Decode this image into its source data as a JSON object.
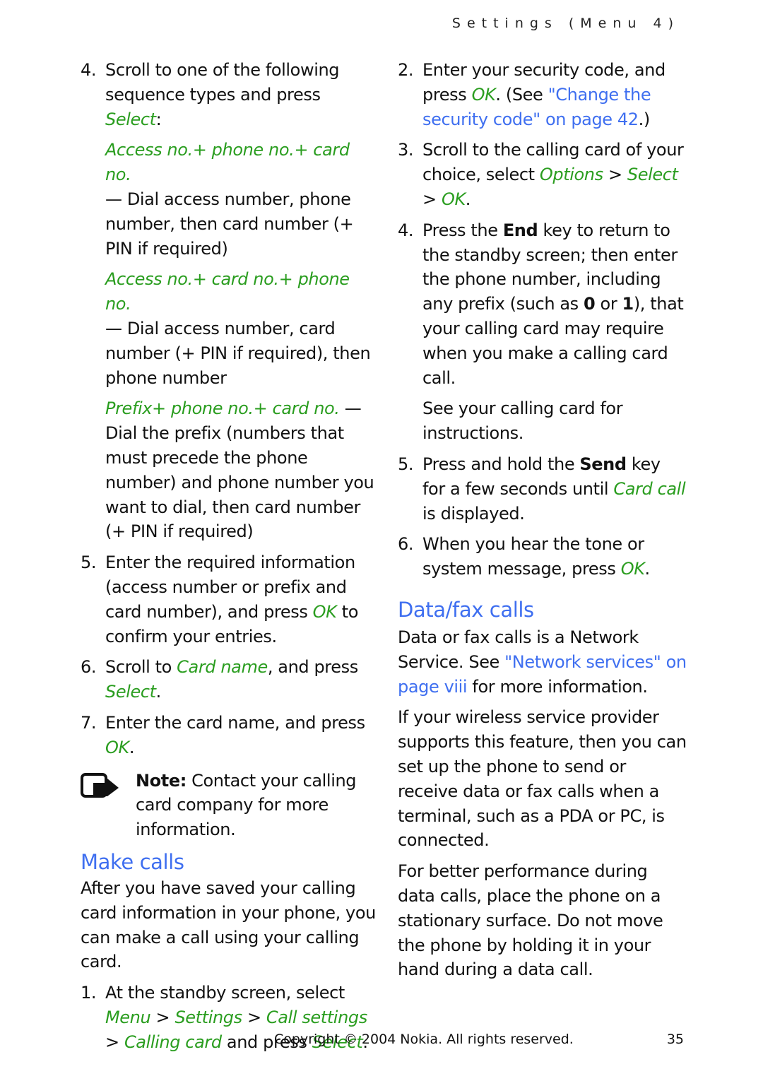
{
  "header": {
    "running_head": "Settings (Menu 4)"
  },
  "left": {
    "step4": {
      "num": "4.",
      "text_a": "Scroll to one of the following sequence types and press ",
      "select": "Select",
      "text_b": ":",
      "options": [
        {
          "name": "Access no.+ phone no.+ card no.",
          "desc": " — Dial access number, phone number, then card number (+ PIN if required)"
        },
        {
          "name": "Access no.+ card no.+ phone no.",
          "desc": " — Dial access number, card number (+ PIN if required), then phone number"
        },
        {
          "name": "Prefix+ phone no.+ card no.",
          "desc": " — Dial the prefix (numbers that must precede the phone number) and phone number you want to dial, then card number (+ PIN if required)"
        }
      ]
    },
    "step5": {
      "num": "5.",
      "text_a": "Enter the required information (access number or prefix and card number), and press ",
      "ok": "OK",
      "text_b": " to confirm your entries."
    },
    "step6": {
      "num": "6.",
      "text_a": "Scroll to ",
      "card_name": "Card name",
      "text_b": ", and press ",
      "select": "Select",
      "text_c": "."
    },
    "step7": {
      "num": "7.",
      "text_a": "Enter the card name, and press ",
      "ok": "OK",
      "text_b": "."
    },
    "note": {
      "label": "Note:",
      "text": " Contact your calling card company for more information."
    },
    "make_calls": {
      "heading": "Make calls",
      "intro": "After you have saved your calling card information in your phone, you can make a call using your calling card.",
      "step1": {
        "num": "1.",
        "text_a": "At the standby screen, select ",
        "menu": "Menu",
        "sep": " > ",
        "settings": "Settings",
        "call_settings": "Call settings",
        "calling_card": "Calling card",
        "text_b": " and press ",
        "select": "Select",
        "text_c": "."
      }
    }
  },
  "right": {
    "step2": {
      "num": "2.",
      "text_a": "Enter your security code, and press ",
      "ok": "OK",
      "text_b": ". (See ",
      "link": "\"Change the security code\" on page 42",
      "text_c": ".)"
    },
    "step3": {
      "num": "3.",
      "text_a": "Scroll to the calling card of your choice, select ",
      "options": "Options",
      "sep": " > ",
      "select": "Select",
      "ok": "OK",
      "text_b": "."
    },
    "step4": {
      "num": "4.",
      "text_a": "Press the ",
      "end": "End",
      "text_b": " key to return to the standby screen; then enter the phone number, including any prefix (such as ",
      "zero": "0",
      "text_c": " or ",
      "one": "1",
      "text_d": "), that your calling card may require when you make a calling card call.",
      "extra": "See your calling card for instructions."
    },
    "step5": {
      "num": "5.",
      "text_a": "Press and hold the ",
      "send": "Send",
      "text_b": " key for a few seconds until ",
      "card_call": "Card call",
      "text_c": " is displayed."
    },
    "step6": {
      "num": "6.",
      "text_a": "When you hear the tone or system message, press ",
      "ok": "OK",
      "text_b": "."
    },
    "data_fax": {
      "heading": "Data/fax calls",
      "p1_a": "Data or fax calls is a Network Service. See ",
      "p1_link": "\"Network services\" on page viii",
      "p1_b": " for more information.",
      "p2": "If your wireless service provider supports this feature, then you can set up the phone to send or receive data or fax calls when a terminal, such as a PDA or PC, is connected.",
      "p3": "For better performance during data calls, place the phone on a stationary surface. Do not move the phone by holding it in your hand during a data call."
    }
  },
  "footer": {
    "copyright": "Copyright © 2004 Nokia. All rights reserved.",
    "page_number": "35"
  },
  "colors": {
    "ui_term": "#2a9d1f",
    "link_heading": "#3f6ff0",
    "text": "#111111"
  }
}
